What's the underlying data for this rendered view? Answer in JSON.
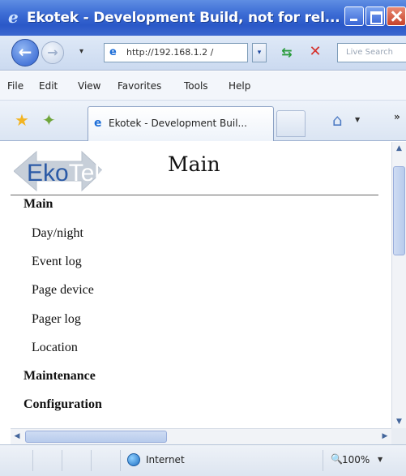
{
  "window": {
    "title": "Ekotek - Development Build, not for rel..."
  },
  "toolbar": {
    "url": "http://192.168.1.2 /",
    "search_placeholder": "Live Search",
    "history_dropdown_glyph": "▾",
    "address_dropdown_glyph": "▾"
  },
  "menu": {
    "items": [
      "File",
      "Edit",
      "View",
      "Favorites",
      "Tools",
      "Help"
    ]
  },
  "tabs": {
    "active_label": "Ekotek - Development Buil...",
    "overflow_glyph": "»"
  },
  "page": {
    "logo_text": "EkoTek",
    "title": "Main",
    "nav": [
      {
        "label": "Main",
        "type": "header"
      },
      {
        "label": "Day/night",
        "type": "link"
      },
      {
        "label": "Event log",
        "type": "link"
      },
      {
        "label": "Page device",
        "type": "link"
      },
      {
        "label": "Pager log",
        "type": "link"
      },
      {
        "label": "Location",
        "type": "link"
      },
      {
        "label": "Maintenance",
        "type": "header"
      },
      {
        "label": "Configuration",
        "type": "header"
      }
    ]
  },
  "status": {
    "zone": "Internet",
    "zoom": "100%"
  },
  "colors": {
    "titlebar": "#3f6fd6",
    "logo_arrow": "#c7cfd9",
    "logo_text_eko": "#2b5aa6",
    "logo_text_tek": "#ffffff"
  }
}
